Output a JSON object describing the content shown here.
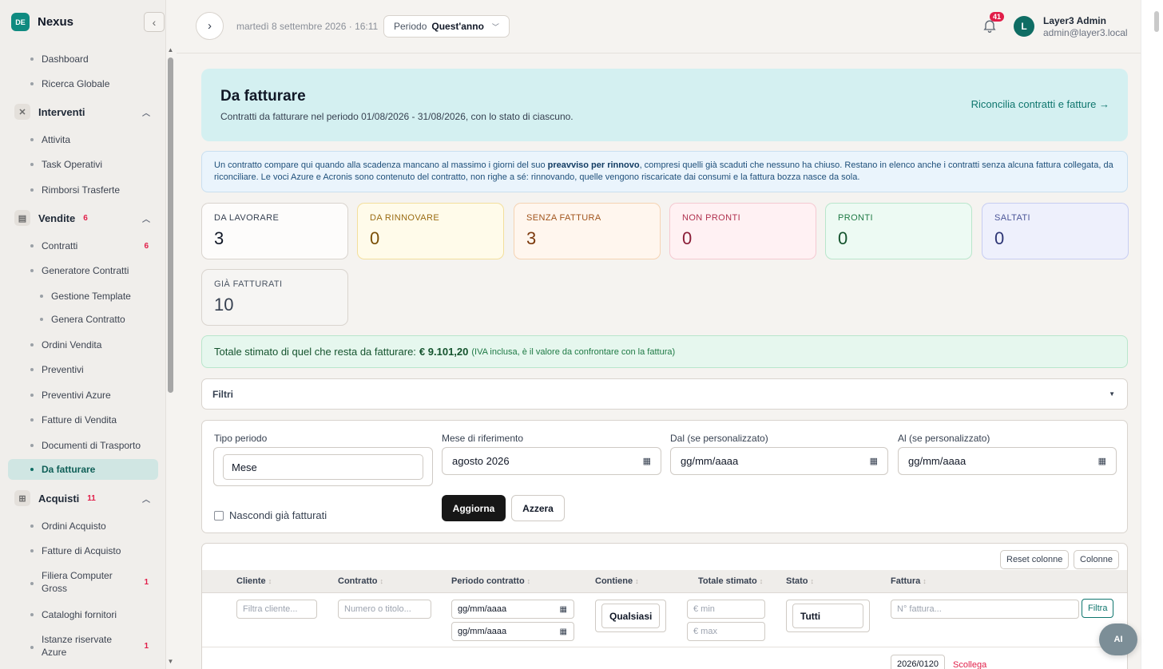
{
  "brand": {
    "badge": "DE",
    "name": "Nexus"
  },
  "sidebar": {
    "items_top": [
      {
        "label": "Dashboard"
      },
      {
        "label": "Ricerca Globale"
      }
    ],
    "groups": {
      "interventi": {
        "label": "Interventi",
        "items": [
          "Attivita",
          "Task Operativi",
          "Rimborsi Trasferte"
        ]
      },
      "vendite": {
        "label": "Vendite",
        "badge": "6",
        "items": [
          "Contratti",
          "Generatore Contratti",
          "Gestione Template",
          "Genera Contratto",
          "Ordini Vendita",
          "Preventivi",
          "Preventivi Azure",
          "Fatture di Vendita",
          "Documenti di Trasporto",
          "Da fatturare"
        ],
        "contratti_badge": "6"
      },
      "acquisti": {
        "label": "Acquisti",
        "badge": "11",
        "items": [
          "Ordini Acquisto",
          "Fatture di Acquisto",
          "Filiera Computer Gross",
          "Cataloghi fornitori",
          "Istanze riservate Azure"
        ],
        "filiera_badge": "1",
        "istanze_badge": "1"
      }
    }
  },
  "topbar": {
    "date": "martedì 8 settembre 2026 · 16:11",
    "period_label": "Periodo",
    "period_value": "Quest'anno",
    "notifications": "41",
    "avatar": "L",
    "user_name": "Layer3 Admin",
    "user_email": "admin@layer3.local"
  },
  "hero": {
    "title": "Da fatturare",
    "subtitle": "Contratti da fatturare nel periodo 01/08/2026 - 31/08/2026, con lo stato di ciascuno.",
    "link": "Riconcilia contratti e fatture →"
  },
  "info": {
    "part1": "Un contratto compare qui quando alla scadenza mancano al massimo i giorni del suo ",
    "bold": "preavviso per rinnovo",
    "part2": ", compresi quelli già scaduti che nessuno ha chiuso. Restano in elenco anche i contratti senza alcuna fattura collegata, da riconciliare. Le voci Azure e Acronis sono contenuto del contratto, non righe a sé: rinnovando, quelle vengono riscaricate dai consumi e la fattura bozza nasce da sola."
  },
  "cards": [
    {
      "label": "DA LAVORARE",
      "value": "3",
      "bg": "#fdfcfb",
      "border": "#d9d4ce",
      "fg": "#374151",
      "vfg": "#111827"
    },
    {
      "label": "DA RINNOVARE",
      "value": "0",
      "bg": "#fffbea",
      "border": "#f3df9c",
      "fg": "#9a6b12",
      "vfg": "#7a4f06"
    },
    {
      "label": "SENZA FATTURA",
      "value": "3",
      "bg": "#fff6ee",
      "border": "#f5d3b3",
      "fg": "#a0531b",
      "vfg": "#7c3a0e"
    },
    {
      "label": "NON PRONTI",
      "value": "0",
      "bg": "#fff1f3",
      "border": "#f5c9d1",
      "fg": "#b0304e",
      "vfg": "#8a1d37"
    },
    {
      "label": "PRONTI",
      "value": "0",
      "bg": "#edfaf3",
      "border": "#b9e6cc",
      "fg": "#1f7a45",
      "vfg": "#14532d"
    },
    {
      "label": "SALTATI",
      "value": "0",
      "bg": "#eef0fc",
      "border": "#c7cdf2",
      "fg": "#4b5597",
      "vfg": "#2e3675"
    },
    {
      "label": "GIÀ FATTURATI",
      "value": "10",
      "bg": "#f6f5f3",
      "border": "#d9d4ce",
      "fg": "#4b5563",
      "vfg": "#374151"
    }
  ],
  "total": {
    "label": "Totale stimato di quel che resta da fatturare:",
    "amount": "€ 9.101,20",
    "note": "(IVA inclusa, è il valore da confrontare con la fattura)"
  },
  "filters": {
    "title": "Filtri",
    "tipo_periodo_label": "Tipo periodo",
    "tipo_periodo_value": "Mese",
    "mese_label": "Mese di riferimento",
    "mese_value": "agosto 2026",
    "dal_label": "Dal (se personalizzato)",
    "dal_placeholder": "gg/mm/aaaa",
    "al_label": "Al (se personalizzato)",
    "al_placeholder": "gg/mm/aaaa",
    "hide_label": "Nascondi già fatturati",
    "update_btn": "Aggiorna",
    "reset_btn": "Azzera"
  },
  "table": {
    "reset_columns": "Reset colonne",
    "columns_btn": "Colonne",
    "headers": [
      "Cliente",
      "Contratto",
      "Periodo contratto",
      "Contiene",
      "Totale stimato",
      "Stato",
      "Fattura"
    ],
    "filter_cliente": "Filtra cliente...",
    "filter_contratto": "Numero o titolo...",
    "filter_date_from": "gg/mm/aaaa",
    "filter_date_to": "gg/mm/aaaa",
    "filter_contiene": "Qualsiasi",
    "filter_min": "€ min",
    "filter_max": "€ max",
    "filter_stato": "Tutti",
    "filter_fattura": "N° fattura...",
    "filter_btn": "Filtra",
    "row_invoice": "2026/0120",
    "row_unlink": "Scollega"
  },
  "ai_button": "AI"
}
